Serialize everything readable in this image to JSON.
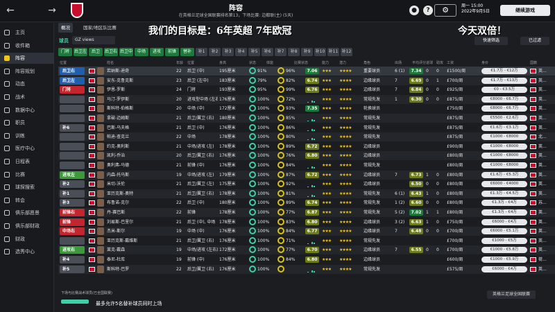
{
  "topbar": {
    "title": "阵容",
    "subtitle": "在英格兰足球全国联赛排名第13，下场比赛: 边都联(主) (5天)",
    "date": "周一 15:00",
    "date2": "2022年9月5日",
    "continue_label": "继续游戏",
    "back": "←",
    "forward": "→"
  },
  "sidebar": {
    "items": [
      {
        "label": "主页"
      },
      {
        "label": "收件箱"
      },
      {
        "label": "阵容"
      },
      {
        "label": "阵容规划"
      },
      {
        "label": "动态"
      },
      {
        "label": "战术"
      },
      {
        "label": "数据中心"
      },
      {
        "label": "职员"
      },
      {
        "label": "训练"
      },
      {
        "label": "医疗中心"
      },
      {
        "label": "日程表"
      },
      {
        "label": "比赛"
      },
      {
        "label": "球探搜索"
      },
      {
        "label": "转会"
      },
      {
        "label": "俱乐部愿景"
      },
      {
        "label": "俱乐部财政"
      },
      {
        "label": "财政"
      },
      {
        "label": "选秀中心"
      }
    ]
  },
  "tabs": [
    {
      "label": "概况"
    },
    {
      "label": "国家/地区队比赛"
    }
  ],
  "overlay_left": "我们的目标是：6年英超 7年欧冠",
  "overlay_right": "今天双倍！",
  "toolbar": {
    "section_label": "球员",
    "view_label": "GZ views",
    "fast_label": "快速筛选",
    "selected_label": "已过滤"
  },
  "chips": [
    {
      "label": "门将",
      "t": "g"
    },
    {
      "label": "后卫左",
      "t": "g"
    },
    {
      "label": "后卫",
      "t": "g"
    },
    {
      "label": "后卫右",
      "t": "g"
    },
    {
      "label": "后卫中",
      "t": "g"
    },
    {
      "label": "中场",
      "t": "g"
    },
    {
      "label": "进攻",
      "t": "g"
    },
    {
      "label": "前锋",
      "t": "g"
    },
    {
      "label": "替补",
      "t": "g"
    },
    {
      "label": "补1",
      "t": "d"
    },
    {
      "label": "补2",
      "t": "d"
    },
    {
      "label": "补3",
      "t": "d"
    },
    {
      "label": "补4",
      "t": "d"
    },
    {
      "label": "补5",
      "t": "d"
    },
    {
      "label": "补6",
      "t": "d"
    },
    {
      "label": "补7",
      "t": "d"
    },
    {
      "label": "补8",
      "t": "d"
    },
    {
      "label": "补9",
      "t": "d"
    },
    {
      "label": "补10",
      "t": "d"
    },
    {
      "label": "补11",
      "t": "d"
    },
    {
      "label": "补12",
      "t": "d"
    }
  ],
  "headers": [
    "位置",
    "姓名",
    "年龄",
    "位置",
    "身高",
    "状态",
    "体能",
    "比赛状态",
    "能力",
    "潜力",
    "角色",
    "出场",
    "平均评分",
    "进球",
    "助攻",
    "工资",
    "身价",
    "国籍"
  ],
  "rows": [
    {
      "slot": "后卫右",
      "c": "blue",
      "name": "若纳斯-迪奇",
      "age": "22",
      "pos": "后卫 (中)",
      "h": "195厘米",
      "cond": "91%",
      "fit": "96%",
      "rate": "7.06",
      "role": "重要球员",
      "apps": "6 (1)",
      "avg": "7.34",
      "gls": "0",
      "ast": "0",
      "wage": "£1500/周",
      "val": "€1.7万 - €12万",
      "nat": "英..."
    },
    {
      "slot": "后卫左",
      "c": "blue",
      "name": "安东-克鲁克斯",
      "age": "23",
      "pos": "后卫 (左中)",
      "h": "183厘米",
      "cond": "79%",
      "fit": "82%",
      "rate": "6.74",
      "role": "边缘球员",
      "apps": "7",
      "avg": "6.69",
      "gls": "0",
      "ast": "1",
      "wage": "£700/周",
      "val": "€1.7万 - €13万",
      "nat": "英..."
    },
    {
      "slot": "门将",
      "c": "red",
      "name": "伊恩-罗斯",
      "age": "24",
      "pos": "门将",
      "h": "193厘米",
      "cond": "95%",
      "fit": "99%",
      "rate": "6.76",
      "role": "边缘球员",
      "apps": "7",
      "avg": "6.84",
      "gls": "0",
      "ast": "0",
      "wage": "£925/周",
      "val": "€0 - €3.5万",
      "nat": "英..."
    },
    {
      "slot": "",
      "c": "",
      "name": "马汀-罗伊斯",
      "age": "20",
      "pos": "进攻型中场 (左右中)",
      "h": "176厘米",
      "cond": "100%",
      "fit": "72%",
      "rate": "",
      "role": "常规先发",
      "apps": "1",
      "avg": "6.30",
      "gls": "0",
      "ast": "0",
      "wage": "£875/周",
      "val": "€8000 - €6.7万",
      "nat": "英..."
    },
    {
      "slot": "",
      "c": "",
      "name": "斯科特-伯格斯",
      "age": "20",
      "pos": "中场 (中)",
      "h": "172厘米",
      "cond": "100%",
      "fit": "93%",
      "rate": "7.35",
      "role": "轮换球员",
      "apps": "",
      "avg": "",
      "gls": "",
      "ast": "",
      "wage": "£750/周",
      "val": "€8000 - €6.7万",
      "nat": "英..."
    },
    {
      "slot": "",
      "c": "",
      "name": "拿破-迈姆斯",
      "age": "21",
      "pos": "后卫/翼卫 (右)",
      "h": "180厘米",
      "cond": "100%",
      "fit": "85%",
      "rate": "",
      "role": "常规先发",
      "apps": "",
      "avg": "",
      "gls": "",
      "ast": "",
      "wage": "£875/周",
      "val": "€5500 - €2.6万",
      "nat": "英..."
    },
    {
      "slot": "补6",
      "c": "grey",
      "name": "巴斯-乌夫格",
      "age": "21",
      "pos": "后卫 (中)",
      "h": "176厘米",
      "cond": "100%",
      "fit": "86%",
      "rate": "",
      "role": "常规先发",
      "apps": "",
      "avg": "",
      "gls": "",
      "ast": "",
      "wage": "£875/周",
      "val": "€1.6万 - €3.1万",
      "nat": "英..."
    },
    {
      "slot": "",
      "c": "",
      "name": "帕迪-查克兰",
      "age": "22",
      "pos": "中场",
      "h": "178厘米",
      "cond": "100%",
      "fit": "80%",
      "rate": "",
      "role": "常规先发",
      "apps": "",
      "avg": "",
      "gls": "",
      "ast": "",
      "wage": "£875/周",
      "val": "€1000 - €8000",
      "nat": "北..."
    },
    {
      "slot": "",
      "c": "",
      "name": "约克-奥利斯",
      "age": "21",
      "pos": "中场/进攻 (左)",
      "h": "178厘米",
      "cond": "100%",
      "fit": "89%",
      "rate": "6.72",
      "role": "边缘球员",
      "apps": "",
      "avg": "",
      "gls": "",
      "ast": "",
      "wage": "£900/周",
      "val": "€1000 - €8000",
      "nat": "英..."
    },
    {
      "slot": "",
      "c": "",
      "name": "凯利-乔治",
      "age": "20",
      "pos": "后卫/翼卫 (右)",
      "h": "176厘米",
      "cond": "100%",
      "fit": "76%",
      "rate": "6.80",
      "role": "边缘球员",
      "apps": "",
      "avg": "",
      "gls": "",
      "ast": "",
      "wage": "£800/周",
      "val": "€1000 - €8000",
      "nat": "英..."
    },
    {
      "slot": "",
      "c": "",
      "name": "奥利弗-马德",
      "age": "21",
      "pos": "前锋 (中)",
      "h": "176厘米",
      "cond": "100%",
      "fit": "84%",
      "rate": "",
      "role": "常规先发",
      "apps": "",
      "avg": "",
      "gls": "",
      "ast": "",
      "wage": "£800/周",
      "val": "€1000 - €8000",
      "nat": "英..."
    },
    {
      "slot": "进攻左",
      "c": "green",
      "name": "内森-托马斯",
      "age": "19",
      "pos": "中场/进攻 (左)",
      "h": "179厘米",
      "cond": "100%",
      "fit": "87%",
      "rate": "6.72",
      "role": "边缘球员",
      "apps": "7",
      "avg": "6.73",
      "gls": "1",
      "ast": "0",
      "wage": "£800/周",
      "val": "€1.6万 - €5.3万",
      "nat": "英..."
    },
    {
      "slot": "补2",
      "c": "grey",
      "name": "米切-沃伦",
      "age": "21",
      "pos": "后卫/翼卫 (左)",
      "h": "175厘米",
      "cond": "100%",
      "fit": "92%",
      "rate": "",
      "role": "边缘球员",
      "apps": "",
      "avg": "6.50",
      "gls": "0",
      "ast": "0",
      "wage": "£800/周",
      "val": "€6000 - €4000",
      "nat": "英..."
    },
    {
      "slot": "补1",
      "c": "grey",
      "name": "亚历克斯-奥特",
      "age": "21",
      "pos": "后卫/翼卫 (右)",
      "h": "178厘米",
      "cond": "100%",
      "fit": "81%",
      "rate": "",
      "role": "常规先发",
      "apps": "6 (1)",
      "avg": "6.43",
      "gls": "1",
      "ast": "0",
      "wage": "£800/周",
      "val": "€1.3万 - €4.5万",
      "nat": "英..."
    },
    {
      "slot": "补3",
      "c": "grey",
      "name": "布鲁诺-克尔",
      "age": "22",
      "pos": "后卫 (中)",
      "h": "180厘米",
      "cond": "100%",
      "fit": "89%",
      "rate": "6.74",
      "role": "常规先发",
      "apps": "1 (2)",
      "avg": "6.60",
      "gls": "0",
      "ast": "0",
      "wage": "£800/周",
      "val": "€1.3万 - €4万",
      "nat": "苏..."
    },
    {
      "slot": "前锋右",
      "c": "red",
      "name": "丹-赛巴斯",
      "age": "22",
      "pos": "前锋",
      "h": "178厘米",
      "cond": "100%",
      "fit": "77%",
      "rate": "6.87",
      "role": "常规先发",
      "apps": "5 (2)",
      "avg": "7.02",
      "gls": "1",
      "ast": "1",
      "wage": "£800/周",
      "val": "€1.3万 - €4万",
      "nat": "英..."
    },
    {
      "slot": "前锋",
      "c": "red",
      "name": "刘易斯-巴里尔",
      "age": "21",
      "pos": "后卫 (中), 中场",
      "h": "178厘米",
      "cond": "100%",
      "fit": "83%",
      "rate": "6.80",
      "role": "边缘球员",
      "apps": "3 (2)",
      "avg": "6.63",
      "gls": "1",
      "ast": "0",
      "wage": "£750/周",
      "val": "€6000 - €4万",
      "nat": "英..."
    },
    {
      "slot": "中场右",
      "c": "red",
      "name": "杰米-斯尔",
      "age": "19",
      "pos": "中场 (中)",
      "h": "176厘米",
      "cond": "100%",
      "fit": "84%",
      "rate": "6.77",
      "role": "边缘球员",
      "apps": "7",
      "avg": "6.48",
      "gls": "0",
      "ast": "0",
      "wage": "£700/周",
      "val": "€6000 - €5.1万",
      "nat": "英..."
    },
    {
      "slot": "",
      "c": "",
      "name": "亚历克斯-戴维斯",
      "age": "21",
      "pos": "后卫/翼卫 (右)",
      "h": "176厘米",
      "cond": "100%",
      "fit": "71%",
      "rate": "",
      "role": "常规先发",
      "apps": "",
      "avg": "",
      "gls": "",
      "ast": "",
      "wage": "£700/周",
      "val": "€1000 - €5万",
      "nat": "英..."
    },
    {
      "slot": "进攻右",
      "c": "green",
      "name": "莱克-戴森",
      "age": "19",
      "pos": "中场/进攻 (左右)",
      "h": "172厘米",
      "cond": "100%",
      "fit": "77%",
      "rate": "6.70",
      "role": "边缘球员",
      "apps": "7",
      "avg": "6.55",
      "gls": "0",
      "ast": "0",
      "wage": "£700/周",
      "val": "€1000 - €5.8万",
      "nat": "英..."
    },
    {
      "slot": "补4",
      "c": "grey",
      "name": "泰尼-杜库",
      "age": "19",
      "pos": "前锋 (中)",
      "h": "176厘米",
      "cond": "100%",
      "fit": "84%",
      "rate": "6.80",
      "role": "边缘球员",
      "apps": "",
      "avg": "",
      "gls": "",
      "ast": "",
      "wage": "£600/周",
      "val": "€1000 - €5.9万",
      "nat": "荷..."
    },
    {
      "slot": "补5",
      "c": "grey",
      "name": "斯科特-巴罗",
      "age": "22",
      "pos": "后卫/翼卫 (右)",
      "h": "176厘米",
      "cond": "100%",
      "fit": "",
      "rate": "",
      "role": "常规先发",
      "apps": "",
      "avg": "",
      "gls": "",
      "ast": "",
      "wage": "£575/周",
      "val": "€6000 - €4万",
      "nat": "英..."
    }
  ],
  "footer": {
    "note": "下场与比赛战术球员(已全国联赛)",
    "info": "最多允许5名替补球员同时上场",
    "league": "英格兰足球全国联赛"
  }
}
